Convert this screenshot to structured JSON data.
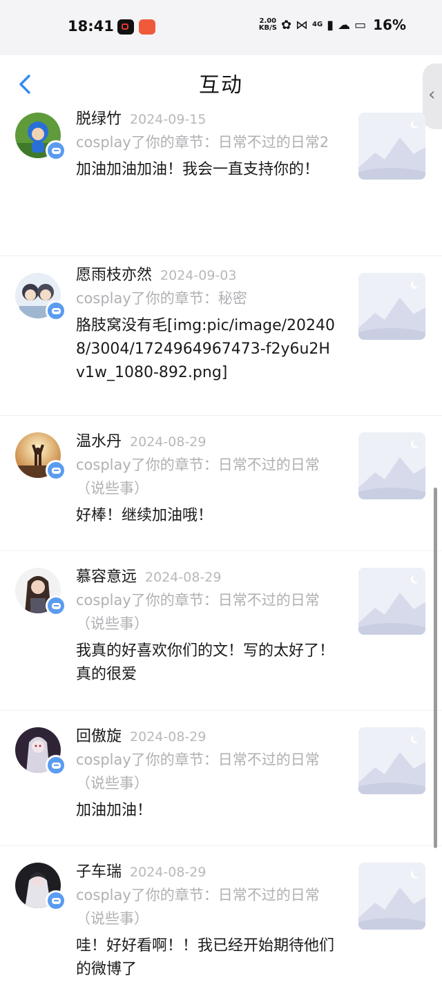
{
  "status_bar": {
    "time": "18:41",
    "net_speed_value": "2.00",
    "net_speed_unit": "KB/S",
    "network": "4G",
    "battery": "16%"
  },
  "header": {
    "title": "互动"
  },
  "items": [
    {
      "username": "脱绿竹",
      "date": "2024-09-15",
      "chapter": "cosplay了你的章节：日常不过的日常2",
      "comment": "加油加油加油！我会一直支持你的！"
    },
    {
      "username": "愿雨枝亦然",
      "date": "2024-09-03",
      "chapter": "cosplay了你的章节：秘密",
      "comment": "胳肢窝没有毛[img:pic/image/202408/3004/1724964967473-f2y6u2Hv1w_1080-892.png]"
    },
    {
      "username": "温水丹",
      "date": "2024-08-29",
      "chapter": "cosplay了你的章节：日常不过的日常（说些事）",
      "comment": "好棒！继续加油哦！"
    },
    {
      "username": "慕容意远",
      "date": "2024-08-29",
      "chapter": "cosplay了你的章节：日常不过的日常（说些事）",
      "comment": "我真的好喜欢你们的文！写的太好了！真的很爱"
    },
    {
      "username": "回傲旋",
      "date": "2024-08-29",
      "chapter": "cosplay了你的章节：日常不过的日常（说些事）",
      "comment": "加油加油！"
    },
    {
      "username": "子车瑞",
      "date": "2024-08-29",
      "chapter": "cosplay了你的章节：日常不过的日常（说些事）",
      "comment": "哇！好好看啊！！我已经开始期待他们的微博了"
    }
  ]
}
